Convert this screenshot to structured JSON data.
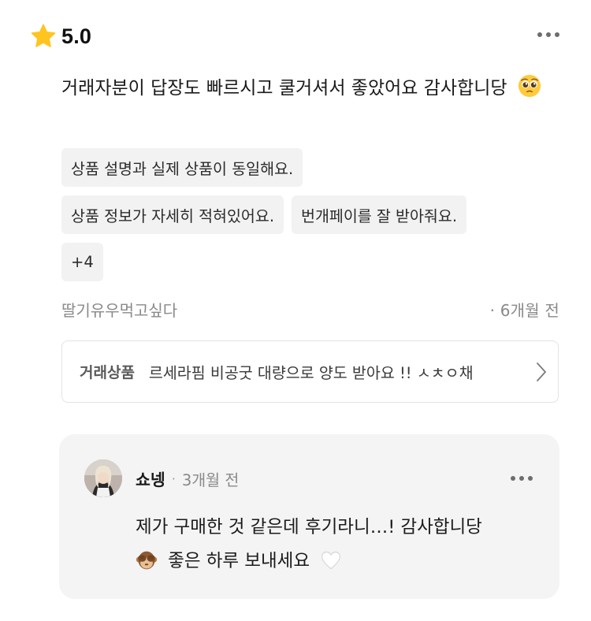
{
  "rating": {
    "value": "5.0",
    "icon": "star-icon",
    "star_color": "#ffc41e"
  },
  "review": {
    "text": "거래자분이 답장도 빠르시고 쿨거셔서 좋았어요 감사합니당",
    "emoji": "pleading-face-icon"
  },
  "tags": [
    "상품 설명과 실제 상품이 동일해요.",
    "상품 정보가 자세히 적혀있어요.",
    "번개페이를 잘 받아줘요.",
    "+4"
  ],
  "meta": {
    "author": "딸기유우먹고싶다",
    "time": "· 6개월 전"
  },
  "product": {
    "label": "거래상품",
    "name": "르세라핌 비공굿 대량으로 양도 받아요 !! ㅅㅊㅇ채"
  },
  "reply": {
    "name": "쇼넹",
    "dot": "·",
    "time": "3개월 전",
    "line1": "제가 구매한 것 같은데 후기라니…! 감사합니당",
    "line2": "좋은 하루 보내세요",
    "icons": [
      "see-no-evil-monkey-icon",
      "white-heart-icon"
    ]
  }
}
